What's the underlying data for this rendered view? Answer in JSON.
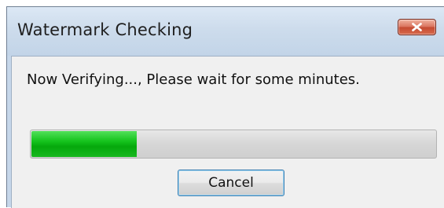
{
  "window": {
    "title": "Watermark Checking",
    "close_icon": "close-icon",
    "close_color": "#c44a31"
  },
  "dialog": {
    "message": "Now Verifying..., Please wait for some minutes.",
    "progress_fraction": 0.26,
    "progress_color": "#14c21c",
    "cancel_label": "Cancel"
  }
}
